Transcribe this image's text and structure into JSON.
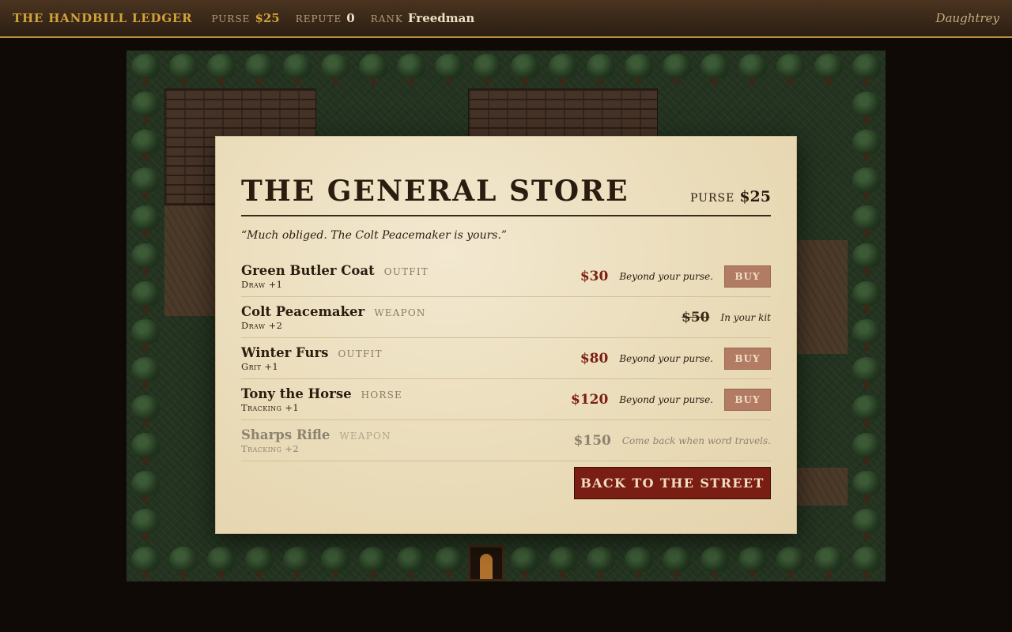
{
  "topbar": {
    "brand": "THE HANDBILL LEDGER",
    "purse_label": "PURSE",
    "purse_value": "$25",
    "repute_label": "REPUTE",
    "repute_value": "0",
    "rank_label": "RANK",
    "rank_value": "Freedman",
    "town": "Daughtrey"
  },
  "store": {
    "title": "THE GENERAL STORE",
    "purse_label": "PURSE",
    "purse_value": "$25",
    "quote": "“Much obliged. The Colt Peacemaker is yours.”",
    "items": [
      {
        "name": "Green Butler Coat",
        "type": "OUTFIT",
        "stat": "Draw +1",
        "price": "$30",
        "note": "Beyond your purse.",
        "action": "BUY",
        "state": "unaffordable"
      },
      {
        "name": "Colt Peacemaker",
        "type": "WEAPON",
        "stat": "Draw +2",
        "price": "$50",
        "note": "In your kit",
        "action": "",
        "state": "owned"
      },
      {
        "name": "Winter Furs",
        "type": "OUTFIT",
        "stat": "Grit +1",
        "price": "$80",
        "note": "Beyond your purse.",
        "action": "BUY",
        "state": "unaffordable"
      },
      {
        "name": "Tony the Horse",
        "type": "HORSE",
        "stat": "Tracking +1",
        "price": "$120",
        "note": "Beyond your purse.",
        "action": "BUY",
        "state": "unaffordable"
      },
      {
        "name": "Sharps Rifle",
        "type": "WEAPON",
        "stat": "Tracking +2",
        "price": "$150",
        "note": "Come back when word travels.",
        "action": "",
        "state": "locked"
      }
    ],
    "back_label": "BACK TO THE STREET"
  },
  "colors": {
    "accent_gold": "#d2a33b",
    "price_red": "#7c1f13",
    "button_red": "#7a1e13",
    "parchment": "#e9dbb7"
  }
}
